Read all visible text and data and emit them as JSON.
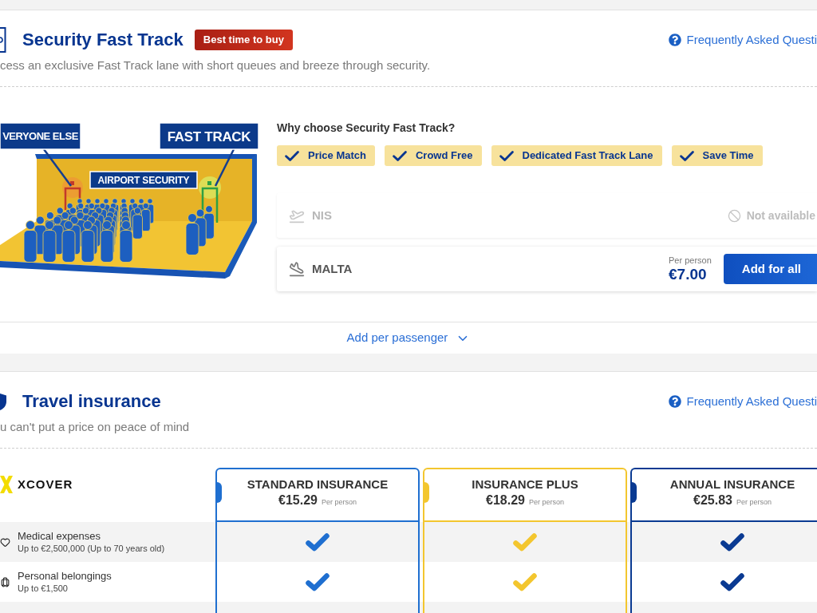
{
  "fast_track": {
    "title": "Security Fast Track",
    "badge": "Best time to buy",
    "faq_link": "Frequently Asked Questi",
    "description": "cess an exclusive Fast Track lane with short queues and breeze through security.",
    "illustration": {
      "signs": [
        "VERYONE ELSE",
        "FAST TRACK",
        "AIRPORT SECURITY"
      ]
    },
    "benefits_heading": "Why choose Security Fast Track?",
    "benefits": [
      "Price Match",
      "Crowd Free",
      "Dedicated Fast Track Lane",
      "Save Time"
    ],
    "flights": [
      {
        "destination": "NIS",
        "available": false,
        "status": "Not available"
      },
      {
        "destination": "MALTA",
        "available": true,
        "price_label": "Per person",
        "price": "€7.00",
        "button": "Add for all"
      }
    ],
    "expand_link": "Add per passenger"
  },
  "travel_insurance": {
    "title": "Travel insurance",
    "faq_link": "Frequently Asked Questi",
    "description": "u can't put a price on peace of mind",
    "provider_logo": "XCOVER",
    "plans": [
      {
        "name": "STANDARD INSURANCE",
        "price": "€15.29",
        "price_note": "Per person",
        "color": "#1f6fd0"
      },
      {
        "name": "INSURANCE PLUS",
        "price": "€18.29",
        "price_note": "Per person",
        "color": "#f3c62e"
      },
      {
        "name": "ANNUAL INSURANCE",
        "price": "€25.83",
        "price_note": "Per person",
        "color": "#0a3a92"
      }
    ],
    "features": [
      {
        "name": "Medical expenses",
        "detail": "Up to €2,500,000 (Up to 70 years old)",
        "included": [
          true,
          true,
          true
        ]
      },
      {
        "name": "Personal belongings",
        "detail": "Up to €1,500",
        "included": [
          true,
          true,
          true
        ]
      }
    ]
  }
}
